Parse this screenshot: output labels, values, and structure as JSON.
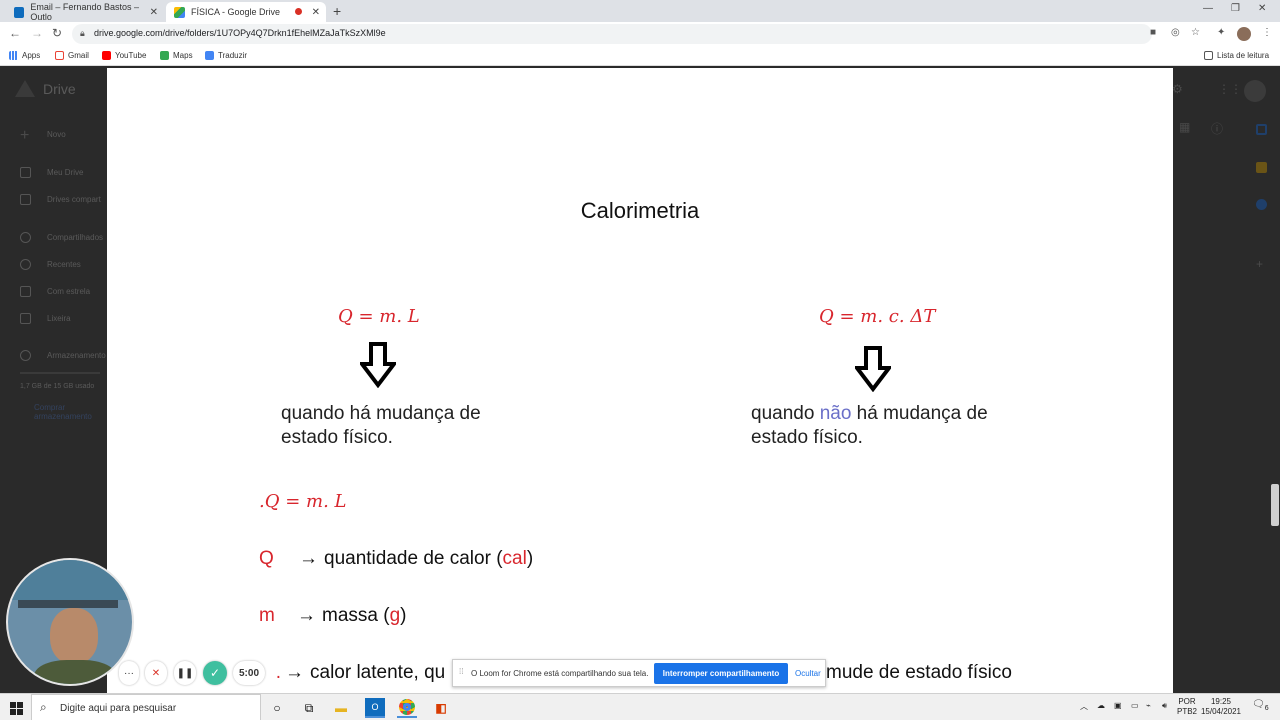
{
  "tabs": [
    {
      "title": "Email – Fernando Bastos – Outlo",
      "active": false
    },
    {
      "title": "FÍSICA - Google Drive",
      "active": true
    }
  ],
  "address": {
    "url": "drive.google.com/drive/folders/1U7OPy4Q7Drkn1fEhelMZaJaTkSzXMl9e"
  },
  "bookmarks": [
    "Apps",
    "Gmail",
    "YouTube",
    "Maps",
    "Traduzir"
  ],
  "reading_list": "Lista de leitura",
  "drive": {
    "logo": "Drive",
    "new_button": "Novo",
    "sidebar": [
      "Meu Drive",
      "Drives compart",
      "Compartilhados",
      "Recentes",
      "Com estrela",
      "Lixeira",
      "Armazenamento"
    ],
    "storage_used": "1,7 GB de 15 GB usado",
    "buy_storage": "Comprar armazenamento"
  },
  "slide": {
    "title": "Calorimetria",
    "formula_left": "Q = m. L",
    "formula_right": "Q = m. c. ΔT",
    "caption_left_1": "quando há mudança de",
    "caption_left_2": "estado físico.",
    "caption_right_1a": "quando ",
    "caption_right_1b": "não",
    "caption_right_1c": " há mudança de",
    "caption_right_2": "estado físico.",
    "formula_list": ".Q = m. L",
    "rows": [
      {
        "sym": "Q",
        "arrow": "→",
        "text": "quantidade de calor (",
        "unit": "cal",
        "close": ")"
      },
      {
        "sym": "m",
        "arrow": "→",
        "text": "massa (",
        "unit": "g",
        "close": ")"
      },
      {
        "sym": ".",
        "arrow": "→",
        "text": "calor latente, qu",
        "tail": "mude de estado físico"
      }
    ]
  },
  "loom": {
    "timer": "5:00",
    "share_message": "O Loom for Chrome está compartilhando sua tela.",
    "stop_button": "Interromper compartilhamento",
    "hide_button": "Ocultar"
  },
  "taskbar": {
    "search_placeholder": "Digite aqui para pesquisar",
    "lang": "POR",
    "layout": "PTB2",
    "time": "19:25",
    "date": "15/04/2021",
    "notifications": "6"
  },
  "colors": {
    "accent_red": "#d8262d",
    "accent_blue": "#6a6fc8",
    "loom_green": "#3fbf9f",
    "button_blue": "#1a73e8"
  }
}
